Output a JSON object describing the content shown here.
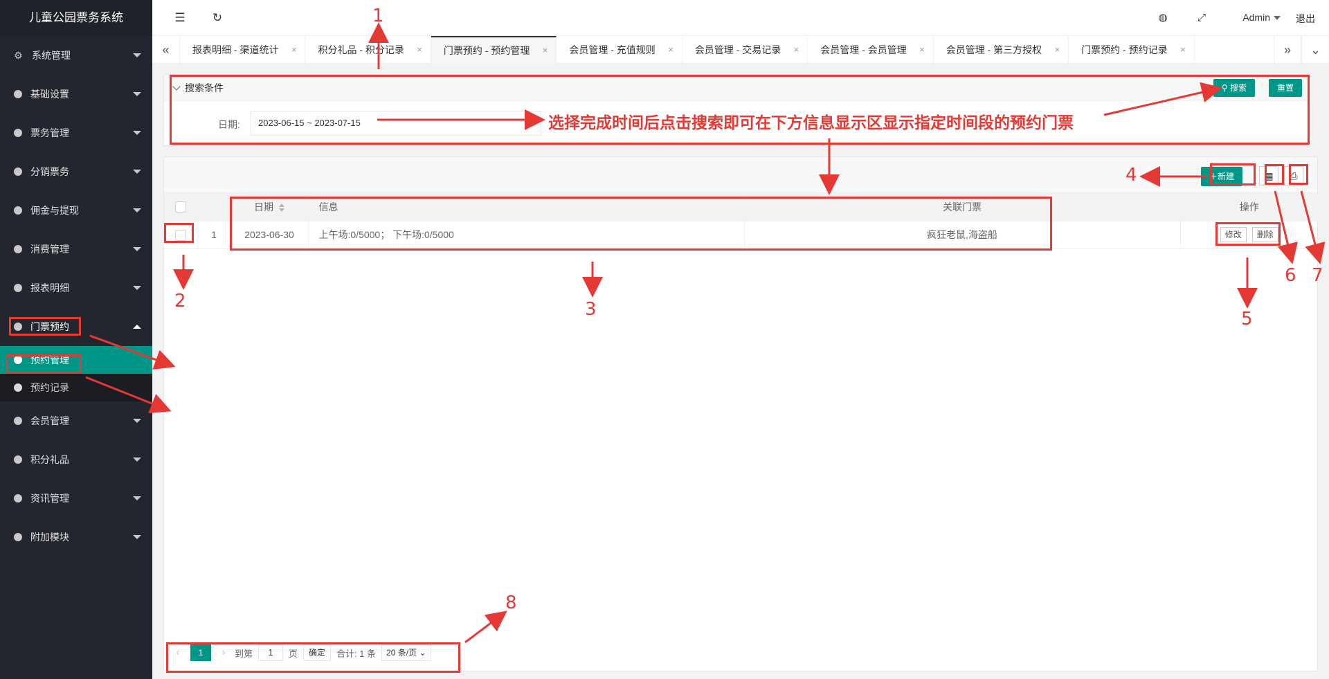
{
  "app_title": "儿童公园票务系统",
  "sidebar": {
    "items": [
      {
        "label": "系统管理",
        "icon": "gear-icon"
      },
      {
        "label": "基础设置",
        "icon": "dot-icon"
      },
      {
        "label": "票务管理",
        "icon": "dot-icon"
      },
      {
        "label": "分销票务",
        "icon": "dot-icon"
      },
      {
        "label": "佣金与提现",
        "icon": "dot-icon"
      },
      {
        "label": "消费管理",
        "icon": "dot-icon"
      },
      {
        "label": "报表明细",
        "icon": "dot-icon"
      },
      {
        "label": "门票预约",
        "icon": "dot-icon",
        "open": true
      },
      {
        "label": "会员管理",
        "icon": "dot-icon"
      },
      {
        "label": "积分礼品",
        "icon": "dot-icon"
      },
      {
        "label": "资讯管理",
        "icon": "dot-icon"
      },
      {
        "label": "附加模块",
        "icon": "dot-icon"
      }
    ],
    "submenu": [
      {
        "label": "预约管理",
        "active": true
      },
      {
        "label": "预约记录"
      }
    ]
  },
  "header": {
    "user": "Admin",
    "logout": "退出"
  },
  "tabs": [
    {
      "label": "报表明细 - 渠道统计"
    },
    {
      "label": "积分礼品 - 积分记录"
    },
    {
      "label": "门票预约 - 预约管理",
      "active": true
    },
    {
      "label": "会员管理 - 充值规则"
    },
    {
      "label": "会员管理 - 交易记录"
    },
    {
      "label": "会员管理 - 会员管理"
    },
    {
      "label": "会员管理 - 第三方授权"
    },
    {
      "label": "门票预约 - 预约记录"
    }
  ],
  "tab_close": "×",
  "search": {
    "title": "搜索条件",
    "search_button": "搜索",
    "reset_button": "重置",
    "date_label": "日期:",
    "date_value": "2023-06-15 ~ 2023-07-15"
  },
  "toolbar": {
    "new_button": "新建"
  },
  "table": {
    "headers": {
      "date": "日期",
      "info": "信息",
      "tickets": "关联门票",
      "ops": "操作"
    },
    "rows": [
      {
        "index": "1",
        "date": "2023-06-30",
        "info": "上午场:0/5000； 下午场:0/5000",
        "tickets": "疯狂老鼠,海盗船",
        "edit": "修改",
        "delete": "删除"
      }
    ]
  },
  "pager": {
    "current": "1",
    "goto_label": "到第",
    "goto_value": "1",
    "page_label": "页",
    "confirm": "确定",
    "total": "合计: 1 条",
    "per_page": "20 条/页"
  },
  "annotations": {
    "note": "选择完成时间后点击搜索即可在下方信息显示区显示指定时间段的预约门票",
    "numbers": [
      "1",
      "2",
      "3",
      "4",
      "5",
      "6",
      "7",
      "8"
    ],
    "color": "#e53935"
  },
  "colors": {
    "accent": "#009688",
    "sidebar": "#23262e"
  }
}
